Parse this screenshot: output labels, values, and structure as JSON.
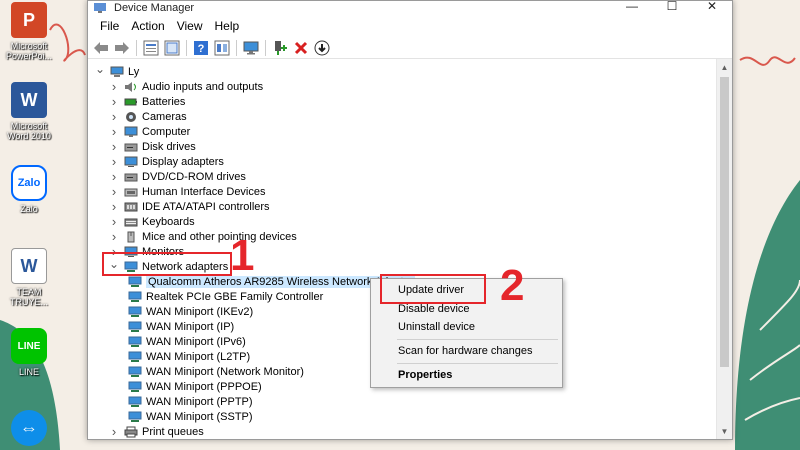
{
  "window": {
    "title": "Device Manager",
    "menus": [
      "File",
      "Action",
      "View",
      "Help"
    ],
    "controls": {
      "minimize": "—",
      "maximize": "☐",
      "close": "✕"
    }
  },
  "toolbar": {
    "buttons": [
      "back-arrow-icon",
      "forward-arrow-icon",
      "properties-icon",
      "show-hidden-icon",
      "help-icon",
      "device-list-icon",
      "monitor-icon",
      "enable-device-icon",
      "remove-device-icon",
      "download-driver-icon"
    ]
  },
  "tree": {
    "root": "Ly",
    "categories": [
      {
        "label": "Audio inputs and outputs",
        "icon": "speaker-icon"
      },
      {
        "label": "Batteries",
        "icon": "battery-icon"
      },
      {
        "label": "Cameras",
        "icon": "camera-icon"
      },
      {
        "label": "Computer",
        "icon": "computer-icon"
      },
      {
        "label": "Disk drives",
        "icon": "disk-drive-icon"
      },
      {
        "label": "Display adapters",
        "icon": "display-adapter-icon"
      },
      {
        "label": "DVD/CD-ROM drives",
        "icon": "dvd-drive-icon"
      },
      {
        "label": "Human Interface Devices",
        "icon": "hid-icon"
      },
      {
        "label": "IDE ATA/ATAPI controllers",
        "icon": "ide-controller-icon"
      },
      {
        "label": "Keyboards",
        "icon": "keyboard-icon"
      },
      {
        "label": "Mice and other pointing devices",
        "icon": "mouse-icon"
      },
      {
        "label": "Monitors",
        "icon": "monitor-icon"
      },
      {
        "label": "Network adapters",
        "icon": "network-adapter-icon",
        "expanded": true
      }
    ],
    "network_adapters": [
      "Qualcomm Atheros AR9285 Wireless Network Adapter",
      "Realtek PCIe GBE Family Controller",
      "WAN Miniport (IKEv2)",
      "WAN Miniport (IP)",
      "WAN Miniport (IPv6)",
      "WAN Miniport (L2TP)",
      "WAN Miniport (Network Monitor)",
      "WAN Miniport (PPPOE)",
      "WAN Miniport (PPTP)",
      "WAN Miniport (SSTP)"
    ],
    "after": {
      "label": "Print queues",
      "icon": "printer-icon"
    }
  },
  "context_menu": {
    "items": [
      "Update driver",
      "Disable device",
      "Uninstall device",
      "Scan for hardware changes",
      "Properties"
    ]
  },
  "annotations": {
    "step1": "1",
    "step2": "2"
  },
  "desktop": {
    "icons": [
      {
        "label": "Microsoft PowerPoi...",
        "icon": "powerpoint-icon",
        "color": "#d24726",
        "glyph": "P"
      },
      {
        "label": "Microsoft Word 2010",
        "icon": "word-icon",
        "color": "#2b579a",
        "glyph": "W"
      },
      {
        "label": "Zalo",
        "icon": "zalo-icon",
        "color": "#0068ff",
        "glyph": "Zalo"
      },
      {
        "label": "TEAM TRUYE...",
        "icon": "word-document-icon",
        "color": "#2b579a",
        "glyph": "W"
      },
      {
        "label": "LINE",
        "icon": "line-icon",
        "color": "#00c300",
        "glyph": "LINE"
      },
      {
        "label": "",
        "icon": "teamviewer-icon",
        "color": "#0e8ee9",
        "glyph": "⇔"
      }
    ]
  },
  "colors": {
    "annotation": "#e5262b",
    "selection": "#cce8ff",
    "menu_bg": "#f2f2f2"
  }
}
